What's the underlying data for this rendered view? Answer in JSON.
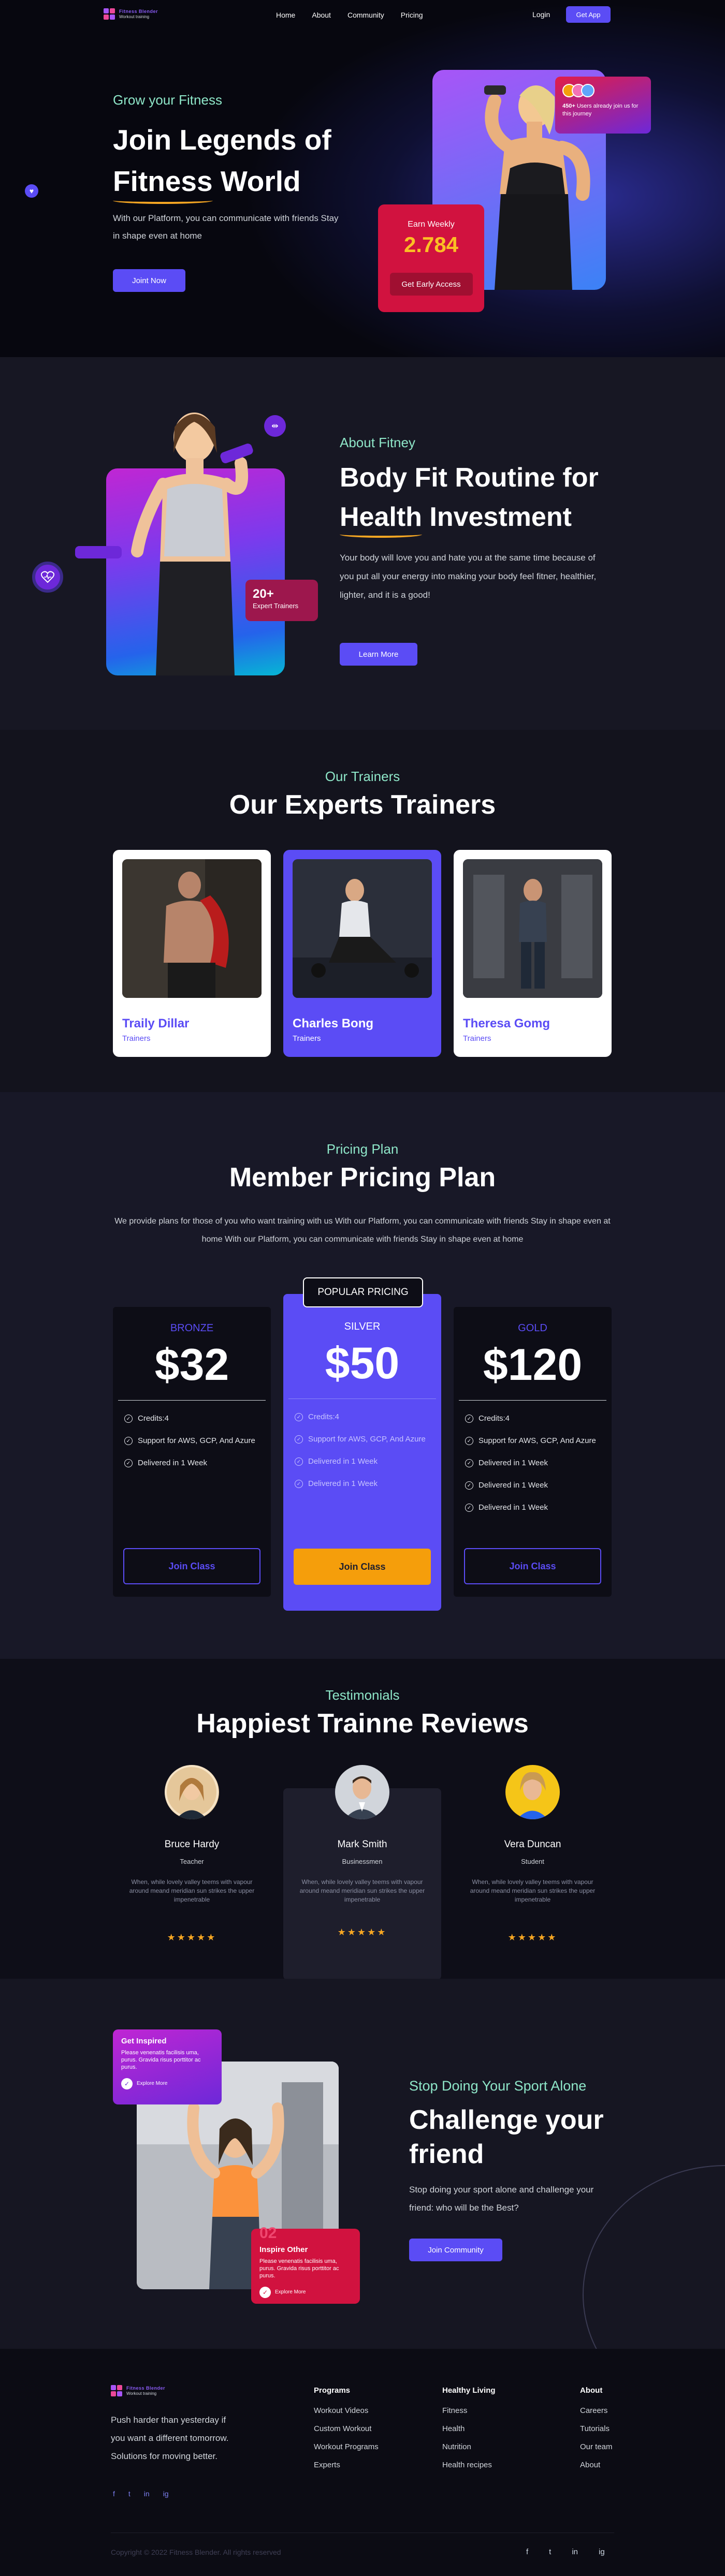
{
  "nav": {
    "logo_title": "Fitness Blender",
    "logo_tagline": "Workout training",
    "links": [
      "Home",
      "About",
      "Community",
      "Pricing"
    ],
    "login": "Login",
    "cta": "Get App"
  },
  "hero": {
    "subtitle": "Grow your Fitness",
    "title_line1": "Join Legends of",
    "title_highlight": "Fitness",
    "title_end": "World",
    "description": "With our Platform, you can communicate with friends Stay in shape even at home",
    "button": "Joint Now",
    "users_count": "450+",
    "users_text": "Users already join us for this journey",
    "earn_label": "Earn Weekly",
    "earn_value": "2.784",
    "earn_button": "Get Early Access"
  },
  "about": {
    "subtitle": "About Fitney",
    "title_line1": "Body Fit Routine for",
    "title_highlight": "Health",
    "title_end": "Investment",
    "description": "Your body will love you and hate you at the same time because of you put all your energy into making your body feel fitner, healthier, lighter, and it is a good!",
    "button": "Learn More",
    "badge_value": "20+",
    "badge_label": "Expert Trainers"
  },
  "trainers": {
    "subtitle": "Our Trainers",
    "title": "Our Experts Trainers",
    "items": [
      {
        "name": "Traily Dillar",
        "role": "Trainers"
      },
      {
        "name": "Charles Bong",
        "role": "Trainers"
      },
      {
        "name": "Theresa Gomg",
        "role": "Trainers"
      }
    ]
  },
  "pricing": {
    "subtitle": "Pricing Plan",
    "title": "Member Pricing Plan",
    "description": "We provide plans for those of you who want training with us With our Platform, you can communicate with friends Stay in shape even at home With our Platform, you can communicate with friends Stay in shape even at home",
    "popular_tag": "POPULAR PRICING",
    "plans": [
      {
        "tier": "BRONZE",
        "price": "$32",
        "features": [
          "Credits:4",
          "Support for AWS, GCP, And Azure",
          "Delivered in 1 Week"
        ],
        "button": "Join Class"
      },
      {
        "tier": "SILVER",
        "price": "$50",
        "features": [
          "Credits:4",
          "Support for AWS, GCP, And Azure",
          "Delivered in 1 Week",
          "Delivered in 1 Week"
        ],
        "button": "Join Class"
      },
      {
        "tier": "GOLD",
        "price": "$120",
        "features": [
          "Credits:4",
          "Support for AWS, GCP, And Azure",
          "Delivered in 1 Week",
          "Delivered in 1 Week",
          "Delivered in 1 Week"
        ],
        "button": "Join Class"
      }
    ]
  },
  "testimonials": {
    "subtitle": "Testimonials",
    "title": "Happiest Trainne Reviews",
    "items": [
      {
        "name": "Bruce Hardy",
        "role": "Teacher",
        "text": "When, while lovely valley teems with vapour around meand meridian sun strikes the upper impenetrable",
        "stars": "★★★★★"
      },
      {
        "name": "Mark Smith",
        "role": "Businessmen",
        "text": "When, while lovely valley teems with vapour around meand meridian sun strikes the upper impenetrable",
        "stars": "★★★★★"
      },
      {
        "name": "Vera Duncan",
        "role": "Student",
        "text": "When, while lovely valley teems with vapour around meand meridian sun strikes the upper impenetrable",
        "stars": "★★★★★"
      }
    ]
  },
  "challenge": {
    "card1_title": "Get Inspired",
    "card1_text": "Please venenatis facilisis uma, purus. Gravida risus porttitor ac purus.",
    "card1_link": "Explore More",
    "card2_number": "02",
    "card2_title": "Inspire Other",
    "card2_text": "Please venenatis facilisis uma, purus. Gravida risus porttitor ac purus.",
    "card2_link": "Explore More",
    "subtitle": "Stop Doing Your Sport Alone",
    "title": "Challenge your friend",
    "description": "Stop doing your sport alone and challenge your friend: who will be the Best?",
    "button": "Join Community"
  },
  "footer": {
    "description": "Push harder than yesterday if you want a different tomorrow. Solutions for moving better.",
    "social": [
      "f",
      "t",
      "in",
      "ig"
    ],
    "columns": [
      {
        "title": "Programs",
        "items": [
          "Workout Videos",
          "Custom Workout",
          "Workout Programs",
          "Experts"
        ]
      },
      {
        "title": "Healthy Living",
        "items": [
          "Fitness",
          "Health",
          "Nutrition",
          "Health recipes"
        ]
      },
      {
        "title": "About",
        "items": [
          "Careers",
          "Tutorials",
          "Our team",
          "About"
        ]
      }
    ],
    "copyright": "Copyright © 2022 Fitness Blender. All rights reserved"
  },
  "colors": {
    "accent": "#5b4cf5",
    "mint": "#8ee6c8",
    "gold": "#f5a623",
    "red": "#d1123f"
  }
}
